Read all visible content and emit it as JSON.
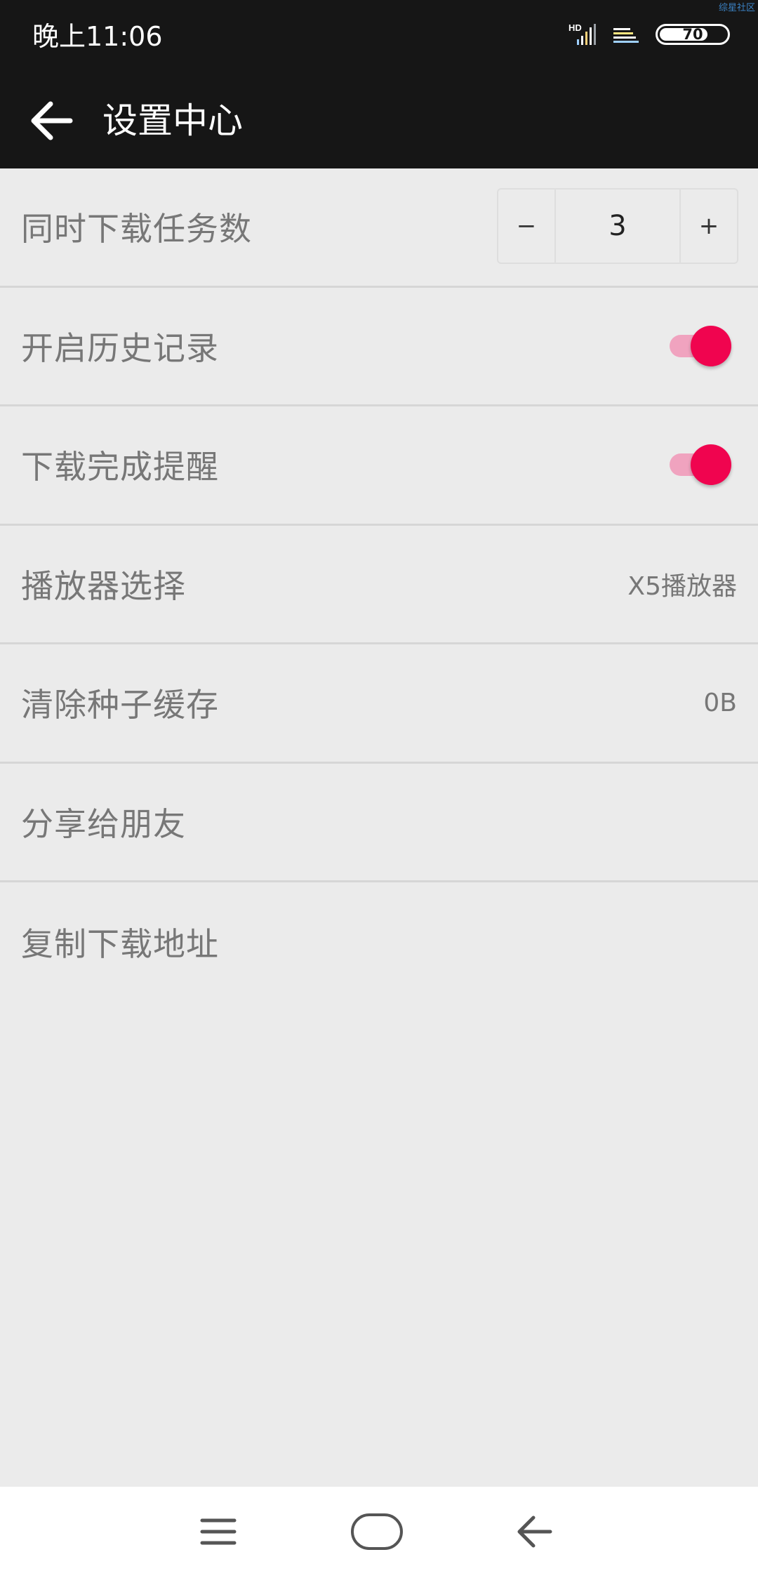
{
  "status_bar": {
    "time": "晚上11:06",
    "network_badge": "HD",
    "battery_level": "70",
    "corner_mark": "综星社区"
  },
  "toolbar": {
    "back_icon": "arrow-left-icon",
    "title": "设置中心"
  },
  "settings": {
    "concurrent_downloads": {
      "label": "同时下载任务数",
      "decrement": "−",
      "value": "3",
      "increment": "+"
    },
    "history": {
      "label": "开启历史记录",
      "enabled": true
    },
    "download_notify": {
      "label": "下载完成提醒",
      "enabled": true
    },
    "player": {
      "label": "播放器选择",
      "value": "X5播放器"
    },
    "clear_cache": {
      "label": "清除种子缓存",
      "value": "0B"
    },
    "share": {
      "label": "分享给朋友"
    },
    "copy_url": {
      "label": "复制下载地址"
    }
  },
  "nav_bar": {
    "icons": [
      "menu-icon",
      "home-icon",
      "back-icon"
    ]
  },
  "colors": {
    "status_bar_bg": "#161616",
    "toolbar_bg": "#161616",
    "page_bg": "#ebebeb",
    "accent": "#f0044f",
    "accent_track": "#f0a3bf",
    "label_text": "#777777"
  }
}
